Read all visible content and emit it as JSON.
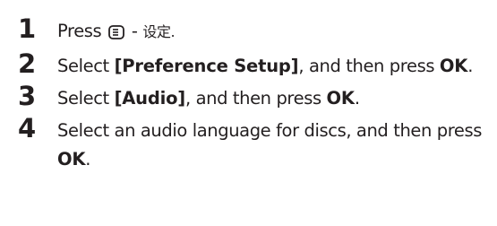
{
  "steps": [
    {
      "number": "1",
      "parts": [
        {
          "text": "Press ",
          "bold": false
        },
        {
          "icon": "menu-button-icon"
        },
        {
          "text": " - ",
          "bold": false
        },
        {
          "text": "设定.",
          "bold": false,
          "cjk": true
        }
      ]
    },
    {
      "number": "2",
      "parts": [
        {
          "text": "Select ",
          "bold": false
        },
        {
          "text": "[Preference Setup]",
          "bold": true
        },
        {
          "text": ", and then press ",
          "bold": false
        },
        {
          "text": "OK",
          "bold": true
        },
        {
          "text": ".",
          "bold": false
        }
      ]
    },
    {
      "number": "3",
      "parts": [
        {
          "text": "Select ",
          "bold": false
        },
        {
          "text": "[Audio]",
          "bold": true
        },
        {
          "text": ", and then press ",
          "bold": false
        },
        {
          "text": "OK",
          "bold": true
        },
        {
          "text": ".",
          "bold": false
        }
      ]
    },
    {
      "number": "4",
      "parts": [
        {
          "text": "Select an audio language for discs, and then press ",
          "bold": false
        },
        {
          "text": "OK",
          "bold": true
        },
        {
          "text": ".",
          "bold": false
        }
      ]
    }
  ]
}
